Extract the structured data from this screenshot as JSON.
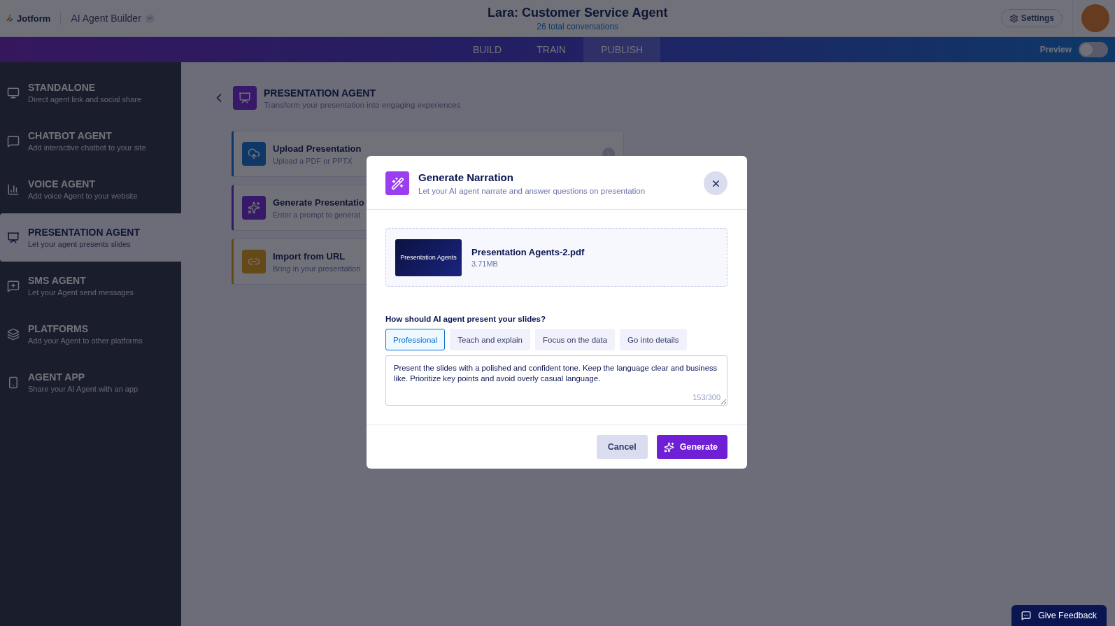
{
  "header": {
    "logo": "Jotform",
    "app_title": "AI Agent Builder",
    "agent_name": "Lara: Customer Service Agent",
    "conversations": "26 total conversations",
    "settings": "Settings"
  },
  "nav": {
    "tabs": [
      {
        "label": "BUILD",
        "selected": false
      },
      {
        "label": "TRAIN",
        "selected": false
      },
      {
        "label": "PUBLISH",
        "selected": true
      }
    ],
    "preview": {
      "label": "Preview",
      "on": false
    }
  },
  "sidebar": {
    "items": [
      {
        "title": "STANDALONE",
        "subtitle": "Direct agent link and social share",
        "selected": false
      },
      {
        "title": "CHATBOT AGENT",
        "subtitle": "Add interactive chatbot to your site",
        "selected": false
      },
      {
        "title": "VOICE AGENT",
        "subtitle": "Add voice Agent to your website",
        "selected": false
      },
      {
        "title": "PRESENTATION AGENT",
        "subtitle": "Let your agent presents slides",
        "selected": true
      },
      {
        "title": "SMS AGENT",
        "subtitle": "Let your Agent send messages",
        "selected": false
      },
      {
        "title": "PLATFORMS",
        "subtitle": "Add your Agent to other platforms",
        "selected": false
      },
      {
        "title": "AGENT APP",
        "subtitle": "Share your AI Agent with an app",
        "selected": false
      }
    ]
  },
  "main": {
    "title": "PRESENTATION AGENT",
    "subtitle": "Transform your presentation into engaging experiences",
    "options": [
      {
        "title": "Upload Presentation",
        "subtitle": "Upload a PDF or PPTX"
      },
      {
        "title": "Generate Presentatio",
        "subtitle": "Enter a prompt to generat"
      },
      {
        "title": "Import from URL",
        "subtitle": "Bring in your presentation"
      }
    ]
  },
  "modal": {
    "title": "Generate Narration",
    "subtitle": "Let your AI agent narrate and answer questions on presentation",
    "file": {
      "name": "Presentation Agents-2.pdf",
      "size": "3.71MB",
      "thumbnail_title": "Presentation Agents"
    },
    "question": "How should AI agent present your slides?",
    "styles": [
      {
        "label": "Professional",
        "selected": true
      },
      {
        "label": "Teach and explain",
        "selected": false
      },
      {
        "label": "Focus on the data",
        "selected": false
      },
      {
        "label": "Go into details",
        "selected": false
      }
    ],
    "prompt": "Present the slides with a polished and confident tone. Keep the language clear and business like. Prioritize key points and avoid overly casual language.",
    "counter": "153/300",
    "cancel": "Cancel",
    "generate": "Generate"
  },
  "feedback": "Give Feedback"
}
